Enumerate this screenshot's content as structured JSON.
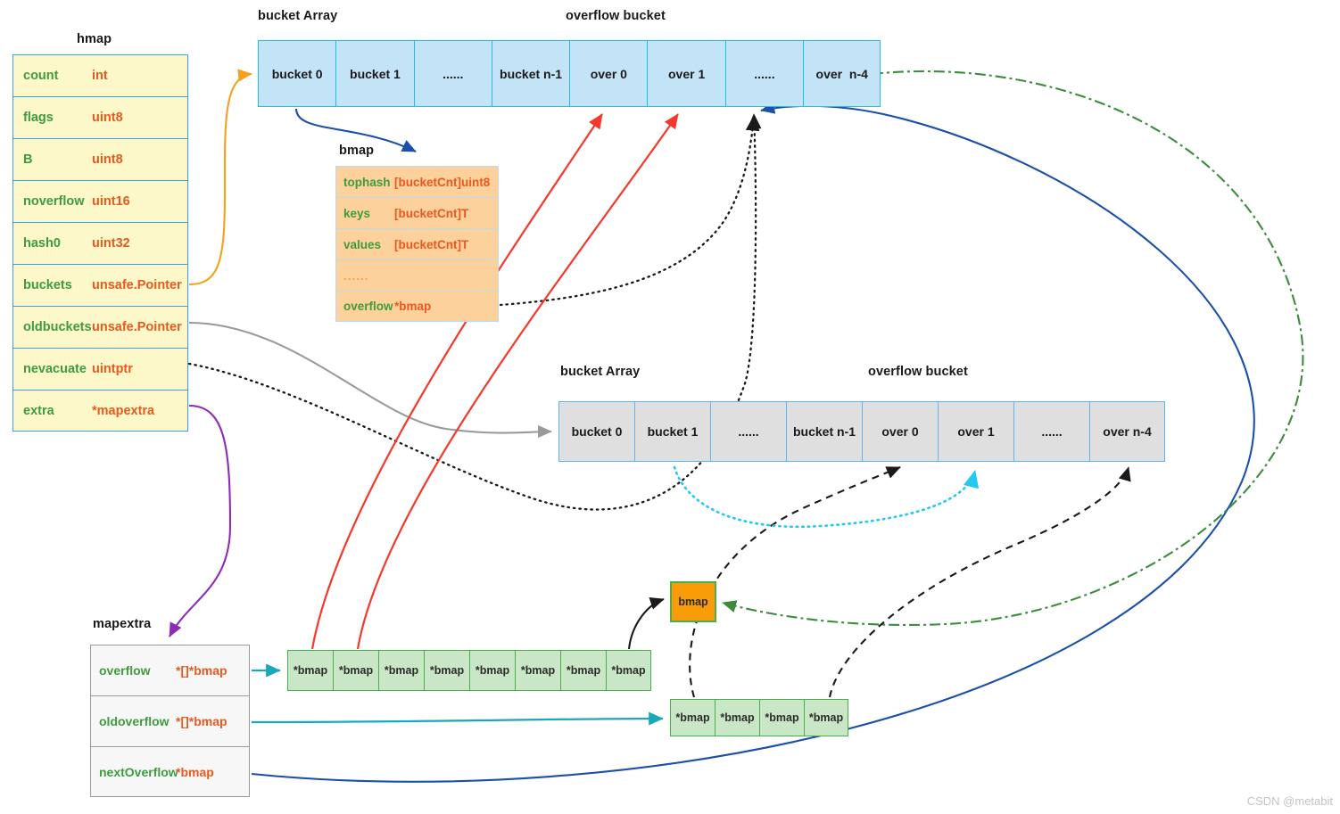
{
  "captions": {
    "hmap": "hmap",
    "bmap": "bmap",
    "mapextra": "mapextra",
    "bucket_array_top": "bucket Array",
    "overflow_bucket_top": "overflow bucket",
    "bucket_array_mid": "bucket Array",
    "overflow_bucket_mid": "overflow bucket"
  },
  "hmap": {
    "fields": [
      {
        "name": "count",
        "type": "int"
      },
      {
        "name": "flags",
        "type": "uint8"
      },
      {
        "name": "B",
        "type": "uint8"
      },
      {
        "name": "noverflow",
        "type": "uint16"
      },
      {
        "name": "hash0",
        "type": "uint32"
      },
      {
        "name": "buckets",
        "type": "unsafe.Pointer"
      },
      {
        "name": "oldbuckets",
        "type": "unsafe.Pointer"
      },
      {
        "name": "nevacuate",
        "type": "uintptr"
      },
      {
        "name": "extra",
        "type": "*mapextra"
      }
    ]
  },
  "bmap": {
    "fields": [
      {
        "name": "tophash",
        "type": "[bucketCnt]uint8"
      },
      {
        "name": "keys",
        "type": "[bucketCnt]T"
      },
      {
        "name": "values",
        "type": "[bucketCnt]T"
      },
      {
        "name": "......",
        "type": ""
      },
      {
        "name": "overflow",
        "type": "*bmap"
      }
    ]
  },
  "mapextra": {
    "fields": [
      {
        "name": "overflow",
        "type": "*[]*bmap"
      },
      {
        "name": "oldoverflow",
        "type": "*[]*bmap"
      },
      {
        "name": "nextOverflow",
        "type": "*bmap"
      }
    ]
  },
  "bucket_array_top": {
    "cells": [
      "bucket 0",
      "bucket 1",
      "......",
      "bucket n-1",
      "over 0",
      "over 1",
      "......",
      "over  n-4"
    ]
  },
  "bucket_array_mid": {
    "cells": [
      "bucket 0",
      "bucket 1",
      "......",
      "bucket n-1",
      "over 0",
      "over 1",
      "......",
      "over n-4"
    ]
  },
  "overflow_array_top": {
    "cells": [
      "*bmap",
      "*bmap",
      "*bmap",
      "*bmap",
      "*bmap",
      "*bmap",
      "*bmap",
      "*bmap"
    ]
  },
  "overflow_array_bottom": {
    "cells": [
      "*bmap",
      "*bmap",
      "*bmap",
      "*bmap"
    ]
  },
  "bmap_node": {
    "label": "bmap"
  },
  "watermark": "CSDN @metabit",
  "colors": {
    "struct_field_name": "#3f9b3f",
    "struct_field_type": "#e8591f",
    "hmap_fill": "#fdf8c9",
    "hmap_border": "#3aa0e8",
    "bmap_fill": "#fcd19c",
    "bmap_border": "#b9dcf3",
    "mapextra_fill": "#f7f7f7",
    "mapextra_border": "#9a9a9a",
    "bucket_top_fill": "#c3e3f7",
    "bucket_top_border": "#22bde4",
    "bucket_mid_fill": "#dfdfdf",
    "bucket_mid_border": "#62b3ec",
    "overflow_cell_fill": "#c9e7c6",
    "overflow_cell_border": "#4aaf4a",
    "bmap_node_fill": "#f89c07",
    "arrow_orange": "#f5a11d",
    "arrow_blue_dark": "#1b4fa8",
    "arrow_red": "#f6372a",
    "arrow_grey": "#9a9a9a",
    "arrow_black": "#1a1a1a",
    "arrow_purple": "#8e2bb5",
    "arrow_teal": "#18a8b8",
    "arrow_cyan": "#24c8f0",
    "arrow_green": "#3d8c3d",
    "watermark": "#c3c3c3"
  }
}
